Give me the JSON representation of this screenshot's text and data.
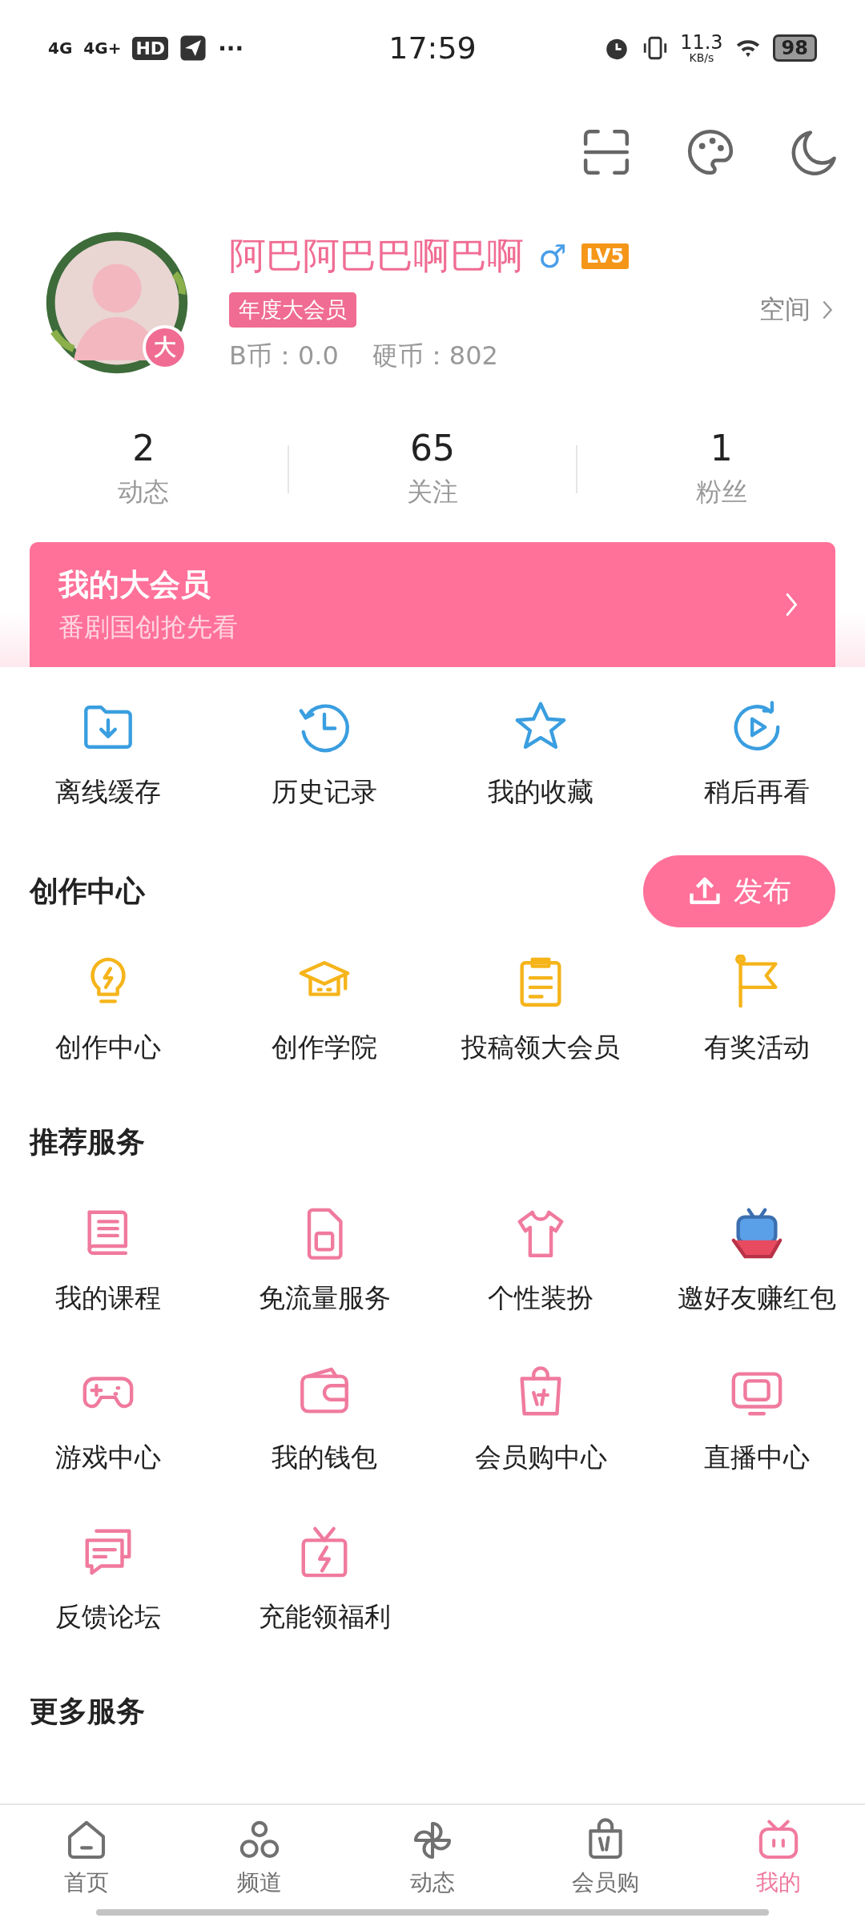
{
  "status_bar": {
    "signals": [
      "4G",
      "4G+"
    ],
    "hd": "HD",
    "more": "···",
    "time": "17:59",
    "speed": "11.3",
    "speed_unit": "KB/s",
    "battery": "98"
  },
  "profile": {
    "name": "阿巴阿巴巴啊巴啊",
    "gender": "♂",
    "level": "LV5",
    "avatar_badge": "大",
    "vip_badge": "年度大会员",
    "space_link": "空间",
    "coins": [
      "B币：0.0",
      "硬币：802"
    ]
  },
  "stats": [
    {
      "value": "2",
      "label": "动态"
    },
    {
      "value": "65",
      "label": "关注"
    },
    {
      "value": "1",
      "label": "粉丝"
    }
  ],
  "vip_banner": {
    "title": "我的大会员",
    "subtitle": "番剧国创抢先看"
  },
  "quick_actions": [
    "离线缓存",
    "历史记录",
    "我的收藏",
    "稍后再看"
  ],
  "creator_center": {
    "title": "创作中心",
    "publish_button": "发布",
    "items": [
      "创作中心",
      "创作学院",
      "投稿领大会员",
      "有奖活动"
    ]
  },
  "recommended_services": {
    "title": "推荐服务",
    "items": [
      "我的课程",
      "免流量服务",
      "个性装扮",
      "邀好友赚红包",
      "游戏中心",
      "我的钱包",
      "会员购中心",
      "直播中心",
      "反馈论坛",
      "充能领福利"
    ]
  },
  "more_services": {
    "title": "更多服务"
  },
  "bottom_nav": [
    {
      "label": "首页",
      "selected": false
    },
    {
      "label": "频道",
      "selected": false
    },
    {
      "label": "动态",
      "selected": false
    },
    {
      "label": "会员购",
      "selected": false
    },
    {
      "label": "我的",
      "selected": true
    }
  ]
}
